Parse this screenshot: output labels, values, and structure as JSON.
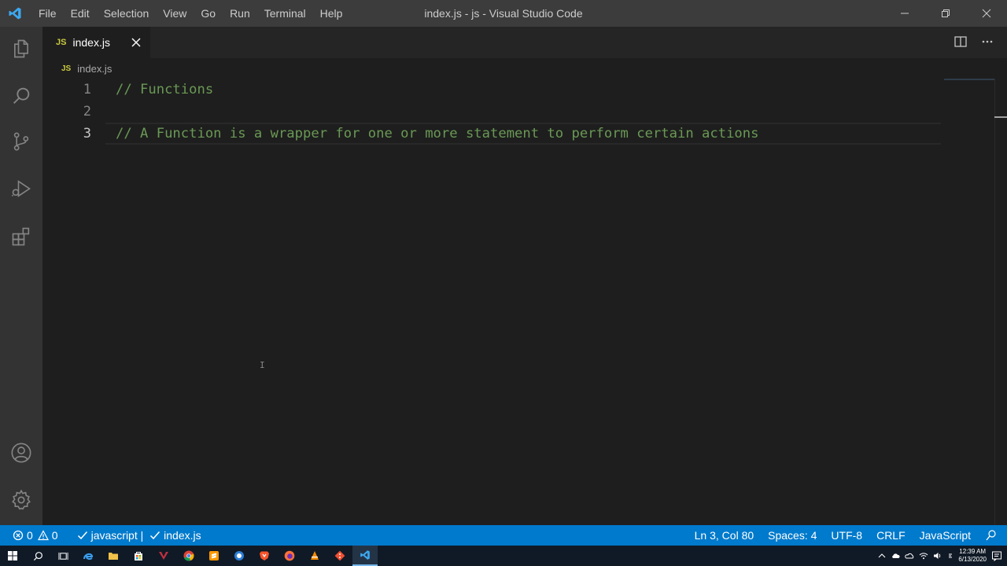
{
  "window": {
    "title": "index.js - js - Visual Studio Code"
  },
  "menu": [
    "File",
    "Edit",
    "Selection",
    "View",
    "Go",
    "Run",
    "Terminal",
    "Help"
  ],
  "activity_bar": {
    "icons": [
      "explorer-icon",
      "search-icon",
      "source-control-icon",
      "run-debug-icon",
      "extensions-icon"
    ],
    "bottom_icons": [
      "accounts-icon",
      "manage-gear-icon"
    ]
  },
  "tab": {
    "badge": "JS",
    "label": "index.js"
  },
  "breadcrumb": {
    "badge": "JS",
    "label": "index.js"
  },
  "editor": {
    "lines": [
      {
        "number": "1",
        "text": "// Functions"
      },
      {
        "number": "2",
        "text": ""
      },
      {
        "number": "3",
        "text": "// A Function is a wrapper for one or more statement to perform certain actions"
      }
    ],
    "active_line": 3,
    "comment_color": "#6a9955"
  },
  "statusbar": {
    "errors": "0",
    "warnings": "0",
    "lint_status": "javascript | ",
    "lint_file": "index.js",
    "position": "Ln 3, Col 80",
    "spaces": "Spaces: 4",
    "encoding": "UTF-8",
    "eol": "CRLF",
    "language": "JavaScript",
    "background": "#007acc"
  },
  "taskbar": {
    "clock_time": "12:39 AM",
    "clock_date": "6/13/2020",
    "apps": [
      "chrome-icon",
      "sublime-icon",
      "app-icon",
      "brave-icon",
      "firefox-icon",
      "vlc-icon",
      "git-icon",
      "vscode-icon"
    ]
  }
}
